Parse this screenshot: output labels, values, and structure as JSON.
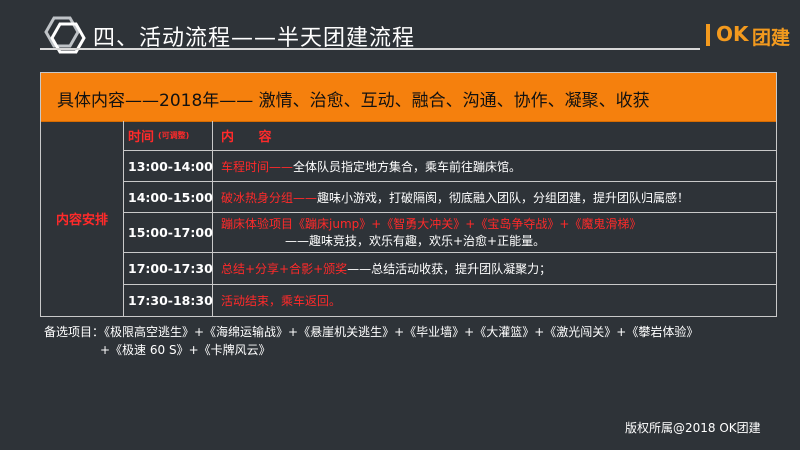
{
  "header": {
    "title": "四、活动流程——半天团建流程",
    "brand": {
      "mark": "OK",
      "name": "团建",
      "color": "#f39a1e"
    }
  },
  "table": {
    "banner": "具体内容——2018年——    激情、治愈、互动、融合、沟通、协作、凝聚、收获",
    "side_label": "内容安排",
    "header": {
      "time": "时间",
      "time_note": "(可调整)",
      "content": "内 容"
    },
    "rows": [
      {
        "time": "13:00-14:00",
        "red": "车程时间——",
        "white": "全体队员指定地方集合，乘车前往蹦床馆。"
      },
      {
        "time": "14:00-15:00",
        "red": "破冰热身分组——",
        "white": "趣味小游戏，打破隔阂，彻底融入团队，分组团建，提升团队归属感！"
      },
      {
        "time": "15:00-17:00",
        "red": "蹦床体验项目《蹦床jump》+《智勇大冲关》+《宝岛争夺战》+《魔鬼滑梯》",
        "white": "——趣味竞技，欢乐有趣，欢乐+治愈+正能量。"
      },
      {
        "time": "17:00-17:30",
        "red": "总结+分享+合影+颁奖",
        "white": "——总结活动收获，提升团队凝聚力；"
      },
      {
        "time": "17:30-18:30",
        "red": "活动结束，乘车返回。",
        "white": ""
      }
    ]
  },
  "notes": {
    "line1": "备选项目：《极限高空逃生》+《海绵运输战》+《悬崖机关逃生》+《毕业墙》+《大灌篮》+《激光闯关》+《攀岩体验》",
    "line2": "+《极速 60 S》+《卡牌风云》"
  },
  "footer": {
    "copyright": "版权所属@2018 OK团建"
  },
  "colors": {
    "background": "#2e3338",
    "banner": "#f5800d",
    "accent_red": "#ff2a2a"
  }
}
